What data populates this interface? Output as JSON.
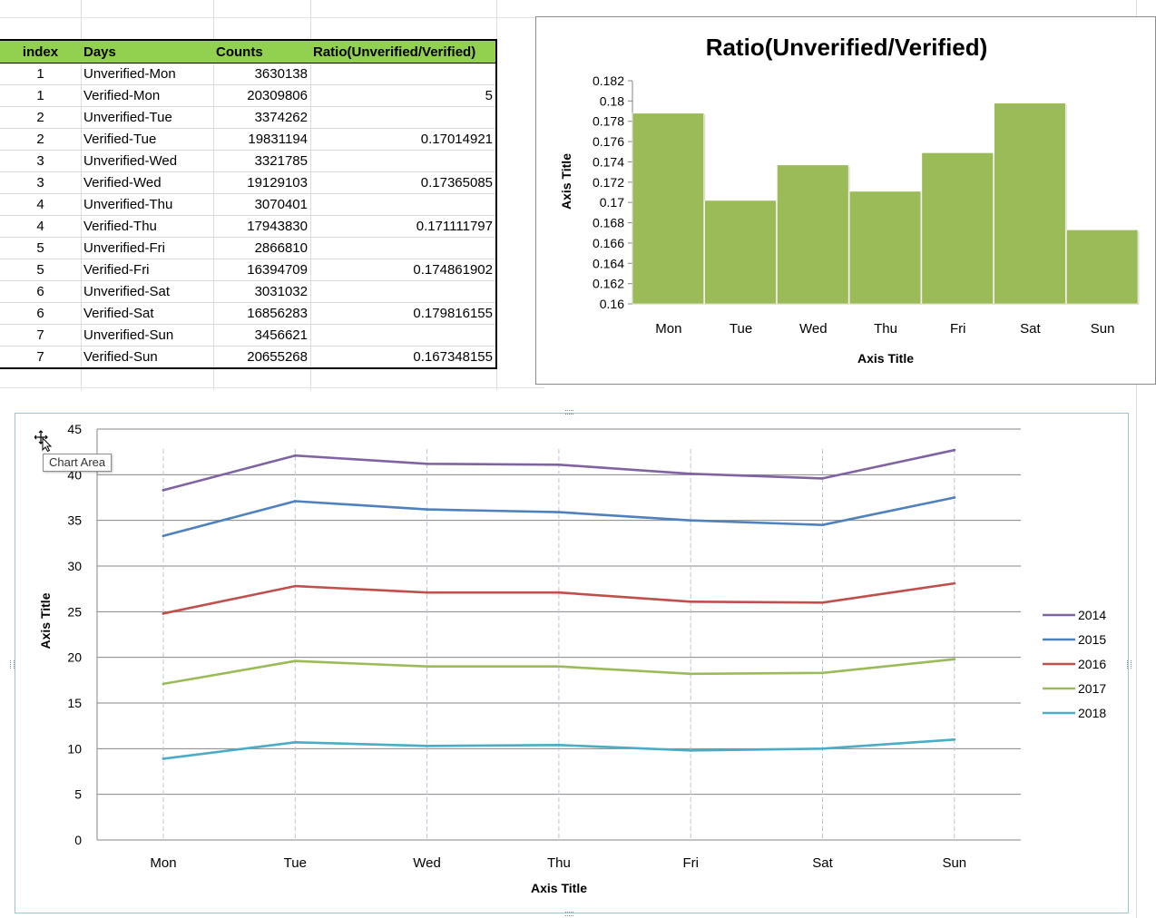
{
  "table": {
    "headers": [
      "index",
      "Days",
      "Counts",
      "Ratio(Unverified/Verified)"
    ],
    "rows": [
      [
        "1",
        "Unverified-Mon",
        "3630138",
        ""
      ],
      [
        "1",
        "Verified-Mon",
        "20309806",
        "5"
      ],
      [
        "2",
        "Unverified-Tue",
        "3374262",
        ""
      ],
      [
        "2",
        "Verified-Tue",
        "19831194",
        "0.17014921"
      ],
      [
        "3",
        "Unverified-Wed",
        "3321785",
        ""
      ],
      [
        "3",
        "Verified-Wed",
        "19129103",
        "0.17365085"
      ],
      [
        "4",
        "Unverified-Thu",
        "3070401",
        ""
      ],
      [
        "4",
        "Verified-Thu",
        "17943830",
        "0.171111797"
      ],
      [
        "5",
        "Unverified-Fri",
        "2866810",
        ""
      ],
      [
        "5",
        "Verified-Fri",
        "16394709",
        "0.174861902"
      ],
      [
        "6",
        "Unverified-Sat",
        "3031032",
        ""
      ],
      [
        "6",
        "Verified-Sat",
        "16856283",
        "0.179816155"
      ],
      [
        "7",
        "Unverified-Sun",
        "3456621",
        ""
      ],
      [
        "7",
        "Verified-Sun",
        "20655268",
        "0.167348155"
      ]
    ],
    "header_color": "#92d050"
  },
  "tooltip": {
    "text": "Chart Area"
  },
  "chart_data": [
    {
      "type": "bar",
      "title": "Ratio(Unverified/Verified)",
      "xlabel": "Axis Title",
      "ylabel": "Axis Title",
      "categories": [
        "Mon",
        "Tue",
        "Wed",
        "Thu",
        "Fri",
        "Sat",
        "Sun"
      ],
      "values": [
        0.1788,
        0.1702,
        0.1737,
        0.1711,
        0.1749,
        0.1798,
        0.1673
      ],
      "ylim": [
        0.16,
        0.182
      ],
      "yticks": [
        0.16,
        0.162,
        0.164,
        0.166,
        0.168,
        0.17,
        0.172,
        0.174,
        0.176,
        0.178,
        0.18,
        0.182
      ],
      "ytick_labels": [
        "0.16",
        "0.162",
        "0.164",
        "0.166",
        "0.168",
        "0.17",
        "0.172",
        "0.174",
        "0.176",
        "0.178",
        "0.18",
        "0.182"
      ],
      "bar_color": "#9bbb59",
      "grid": false
    },
    {
      "type": "line",
      "title": "",
      "xlabel": "Axis Title",
      "ylabel": "Axis Title",
      "categories": [
        "Mon",
        "Tue",
        "Wed",
        "Thu",
        "Fri",
        "Sat",
        "Sun"
      ],
      "ylim": [
        0,
        45
      ],
      "yticks": [
        0,
        5,
        10,
        15,
        20,
        25,
        30,
        35,
        40,
        45
      ],
      "grid": true,
      "legend": "right",
      "series": [
        {
          "name": "2014",
          "color": "#8064a2",
          "values": [
            38.3,
            42.1,
            41.2,
            41.1,
            40.1,
            39.6,
            42.7
          ]
        },
        {
          "name": "2015",
          "color": "#4f81bd",
          "values": [
            33.3,
            37.1,
            36.2,
            35.9,
            35.0,
            34.5,
            37.5
          ]
        },
        {
          "name": "2016",
          "color": "#c0504d",
          "values": [
            24.8,
            27.8,
            27.1,
            27.1,
            26.1,
            26.0,
            28.1
          ]
        },
        {
          "name": "2017",
          "color": "#9bbb59",
          "values": [
            17.1,
            19.6,
            19.0,
            19.0,
            18.2,
            18.3,
            19.8
          ]
        },
        {
          "name": "2018",
          "color": "#4bacc6",
          "values": [
            8.9,
            10.7,
            10.3,
            10.4,
            9.8,
            10.0,
            11.0
          ]
        }
      ]
    }
  ]
}
